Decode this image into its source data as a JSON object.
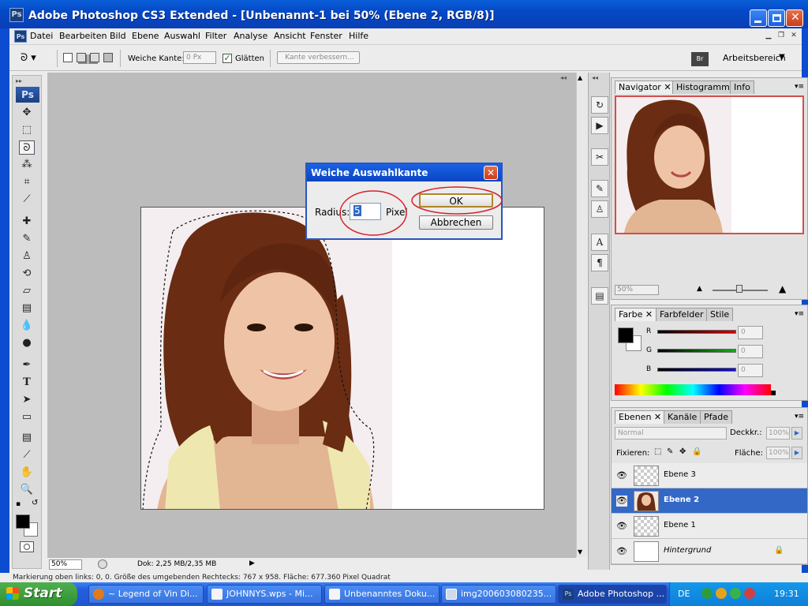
{
  "window": {
    "title": "Adobe Photoshop CS3 Extended - [Unbenannt-1 bei 50% (Ebene 2, RGB/8)]",
    "app_icon": "Ps"
  },
  "menu": [
    "Datei",
    "Bearbeiten",
    "Bild",
    "Ebene",
    "Auswahl",
    "Filter",
    "Analyse",
    "Ansicht",
    "Fenster",
    "Hilfe"
  ],
  "options": {
    "soft_edge_label": "Weiche Kante:",
    "soft_edge_value": "0 Px",
    "smooth_label": "Glätten",
    "refine_label": "Kante verbessern...",
    "workspace_label": "Arbeitsbereich"
  },
  "toolbox": {
    "logo": "Ps"
  },
  "dialog": {
    "title": "Weiche Auswahlkante",
    "radius_label": "Radius:",
    "radius_value": "5",
    "unit": "Pixel",
    "ok": "OK",
    "cancel": "Abbrechen"
  },
  "status": {
    "zoom": "50%",
    "doc": "Dok: 2,25 MB/2,35 MB"
  },
  "hint": "Markierung oben links: 0, 0. Größe des umgebenden Rechtecks: 767 x 958. Fläche: 677.360 Pixel Quadrat",
  "navigator": {
    "tabs": [
      "Navigator",
      "Histogramm",
      "Info"
    ],
    "zoom": "50%"
  },
  "color_panel": {
    "tabs": [
      "Farbe",
      "Farbfelder",
      "Stile"
    ],
    "channels": [
      {
        "label": "R",
        "value": "0",
        "color": "#d00000"
      },
      {
        "label": "G",
        "value": "0",
        "color": "#10b010"
      },
      {
        "label": "B",
        "value": "0",
        "color": "#1010d0"
      }
    ]
  },
  "layers_panel": {
    "tabs": [
      "Ebenen",
      "Kanäle",
      "Pfade"
    ],
    "blend_mode": "Normal",
    "opacity_label": "Deckkr.:",
    "opacity": "100%",
    "lock_label": "Fixieren:",
    "fill_label": "Fläche:",
    "fill": "100%",
    "layers": [
      {
        "name": "Ebene 3",
        "selected": false
      },
      {
        "name": "Ebene 2",
        "selected": true
      },
      {
        "name": "Ebene 1",
        "selected": false
      },
      {
        "name": "Hintergrund",
        "selected": false
      }
    ]
  },
  "taskbar": {
    "start": "Start",
    "tasks": [
      "~ Legend of Vin Di...",
      "JOHNNYS.wps - Mi...",
      "Unbenanntes Doku...",
      "img200603080235...",
      "Adobe Photoshop ..."
    ],
    "lang": "DE",
    "clock": "19:31"
  }
}
